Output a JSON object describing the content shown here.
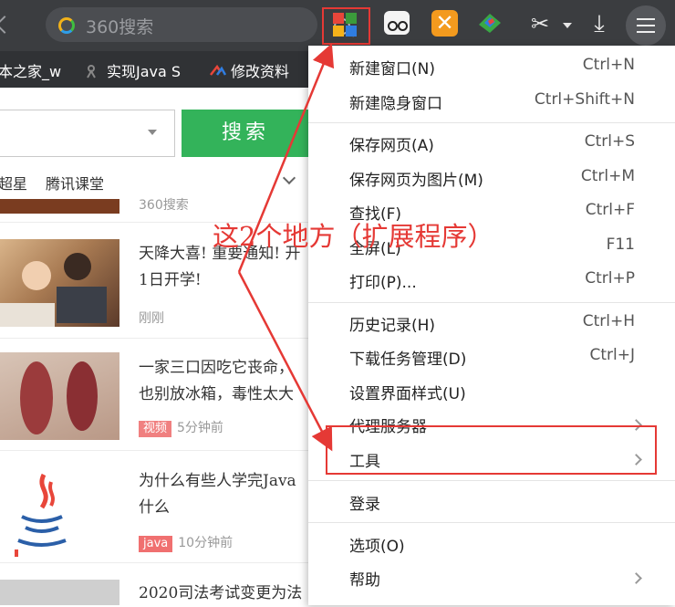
{
  "address_bar": {
    "placeholder": "360搜索"
  },
  "bookmarks": [
    {
      "label": "本之家_w"
    },
    {
      "label": "实现Java S"
    },
    {
      "label": "修改资料"
    }
  ],
  "page": {
    "search_button": "搜索",
    "quick_links": [
      "超星",
      "腾讯课堂"
    ],
    "top_source": "360搜索",
    "news": [
      {
        "title_lines": [
          "天降大喜! 重要通知! 开",
          "1日开学!"
        ],
        "time": "刚刚",
        "tag": ""
      },
      {
        "title_lines": [
          "一家三口因吃它丧命，",
          "也别放冰箱，毒性太大"
        ],
        "time": "5分钟前",
        "tag": "视频",
        "tag_color": "#f08080"
      },
      {
        "title_lines": [
          "为什么有些人学完Java",
          "什么"
        ],
        "time": "10分钟前",
        "tag": "java",
        "tag_color": "#f07070"
      },
      {
        "title_lines": [
          "2020司法考试变更为法"
        ],
        "time": "",
        "tag": ""
      }
    ]
  },
  "menu": {
    "items": [
      {
        "label": "新建窗口(N)",
        "shortcut": "Ctrl+N"
      },
      {
        "label": "新建隐身窗口",
        "shortcut": "Ctrl+Shift+N"
      },
      {
        "label": "保存网页(A)",
        "shortcut": "Ctrl+S"
      },
      {
        "label": "保存网页为图片(M)",
        "shortcut": "Ctrl+M"
      },
      {
        "label": "查找(F)",
        "shortcut": "Ctrl+F"
      },
      {
        "label": "全屏(L)",
        "shortcut": "F11"
      },
      {
        "label": "打印(P)...",
        "shortcut": "Ctrl+P"
      },
      {
        "label": "历史记录(H)",
        "shortcut": "Ctrl+H"
      },
      {
        "label": "下载任务管理(D)",
        "shortcut": "Ctrl+J"
      },
      {
        "label": "设置界面样式(U)",
        "shortcut": ""
      },
      {
        "label": "代理服务器",
        "shortcut": ""
      },
      {
        "label": "工具",
        "shortcut": ""
      },
      {
        "label": "登录",
        "shortcut": ""
      },
      {
        "label": "选项(O)",
        "shortcut": ""
      },
      {
        "label": "帮助",
        "shortcut": ""
      }
    ]
  },
  "annotation": {
    "text": "这2个地方（扩展程序）",
    "color": "#e53935"
  }
}
